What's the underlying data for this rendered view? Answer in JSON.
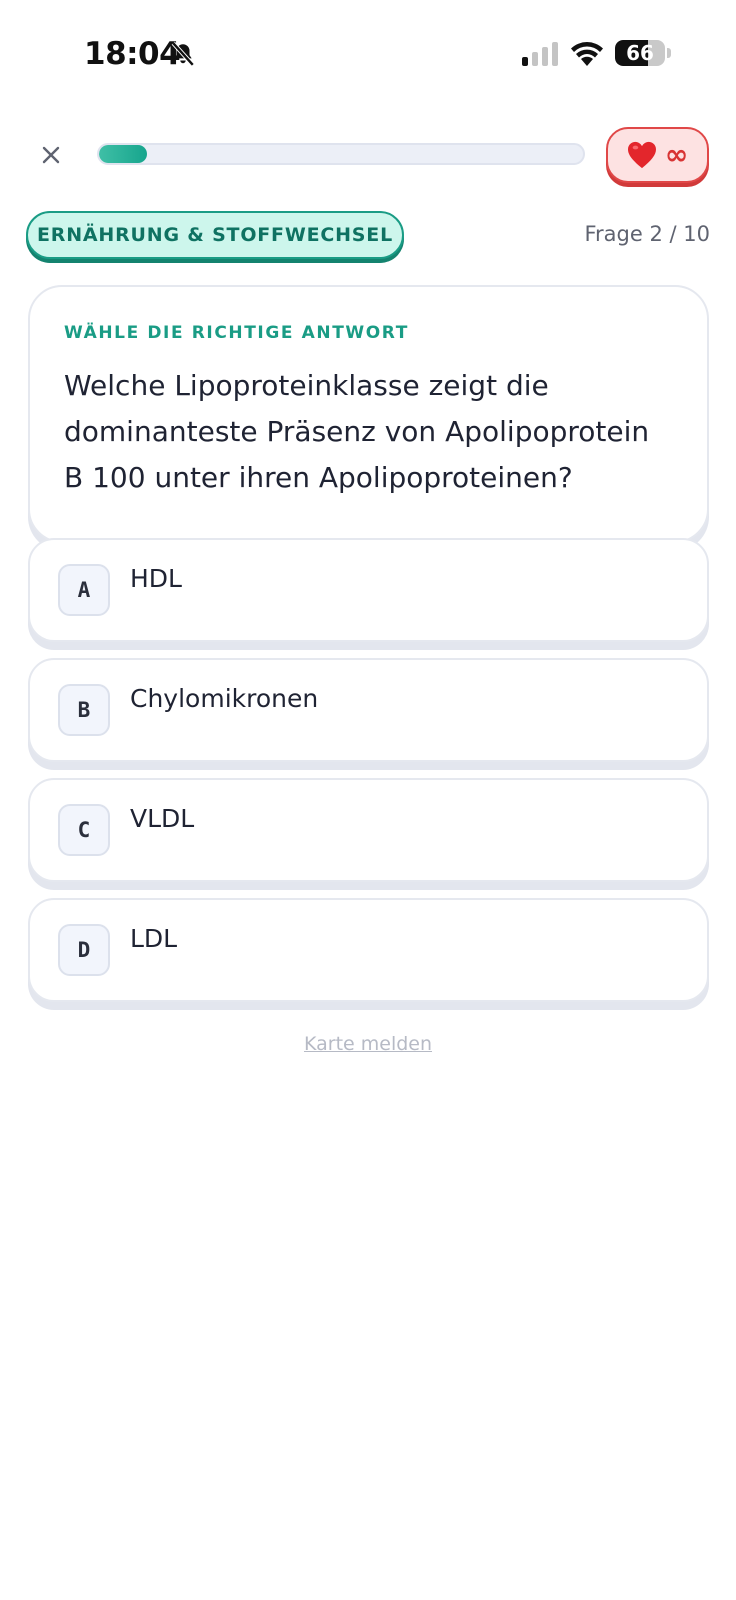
{
  "status_bar": {
    "time": "18:04",
    "battery_level": "66",
    "icons": [
      "bell-slash-icon",
      "signal-icon",
      "wifi-icon",
      "battery-icon"
    ]
  },
  "header": {
    "close_icon": "close-icon",
    "progress_fraction": 0.1,
    "lives": {
      "icon": "heart-icon",
      "count": "∞"
    }
  },
  "category": {
    "label": "ERNÄHRUNG & STOFFWECHSEL",
    "counter": "Frage 2 / 10"
  },
  "question": {
    "instruction": "WÄHLE DIE RICHTIGE ANTWORT",
    "text": "Welche Lipoproteinklasse zeigt die dominanteste Präsenz von Apolipoprotein B 100 unter ihren Apolipoproteinen?"
  },
  "answers": [
    {
      "letter": "A",
      "text": "HDL"
    },
    {
      "letter": "B",
      "text": "Chylomikronen"
    },
    {
      "letter": "C",
      "text": "VLDL"
    },
    {
      "letter": "D",
      "text": "LDL"
    }
  ],
  "footer": {
    "report_label": "Karte melden"
  },
  "colors": {
    "accent": "#1a9c85",
    "progress": "#17a58d",
    "lives_border": "#e04848",
    "lives_bg": "#fde2e2"
  }
}
